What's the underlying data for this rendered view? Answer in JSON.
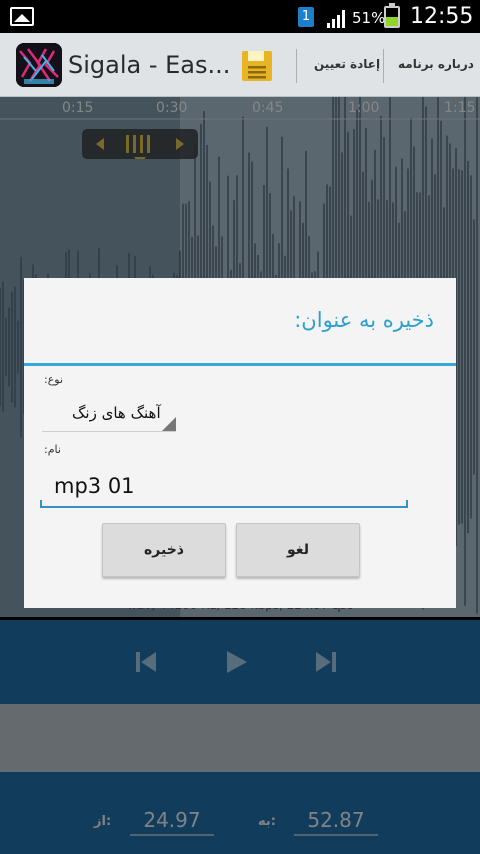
{
  "status_bar": {
    "notification_badge": "1",
    "battery_percent": "51%",
    "battery_level": 0.51,
    "time": "12:55",
    "icons": [
      "picture-notification-icon",
      "signal-icon",
      "battery-icon"
    ]
  },
  "action_bar": {
    "title": "Sigala - Eas...",
    "menu": [
      "إعادة تعيين",
      "درباره برنامه"
    ],
    "icons": [
      "app-logo-icon",
      "save-icon"
    ]
  },
  "timeline": {
    "labels": [
      "0:15",
      "0:30",
      "0:45",
      "1:00",
      "1:15"
    ]
  },
  "info_line": "wav, 44100 Hz, 128 kbps, 224.97 sec",
  "playback": {
    "icons": [
      "previous-icon",
      "play-icon",
      "next-icon"
    ]
  },
  "range": {
    "start_label": "از:",
    "start_value": "24.97",
    "end_label": "به:",
    "end_value": "52.87"
  },
  "dialog": {
    "title": "ذخیره به عنوان:",
    "type_label": "نوع:",
    "type_value": "آهنگ های زنگ",
    "name_label": "نام:",
    "name_value": "mp3 01",
    "save_button": "ذخیره",
    "cancel_button": "لغو"
  },
  "colors": {
    "accent": "#35aad9",
    "control_bar": "#1f6ea7",
    "dialog_bg": "#f4f4f4"
  }
}
